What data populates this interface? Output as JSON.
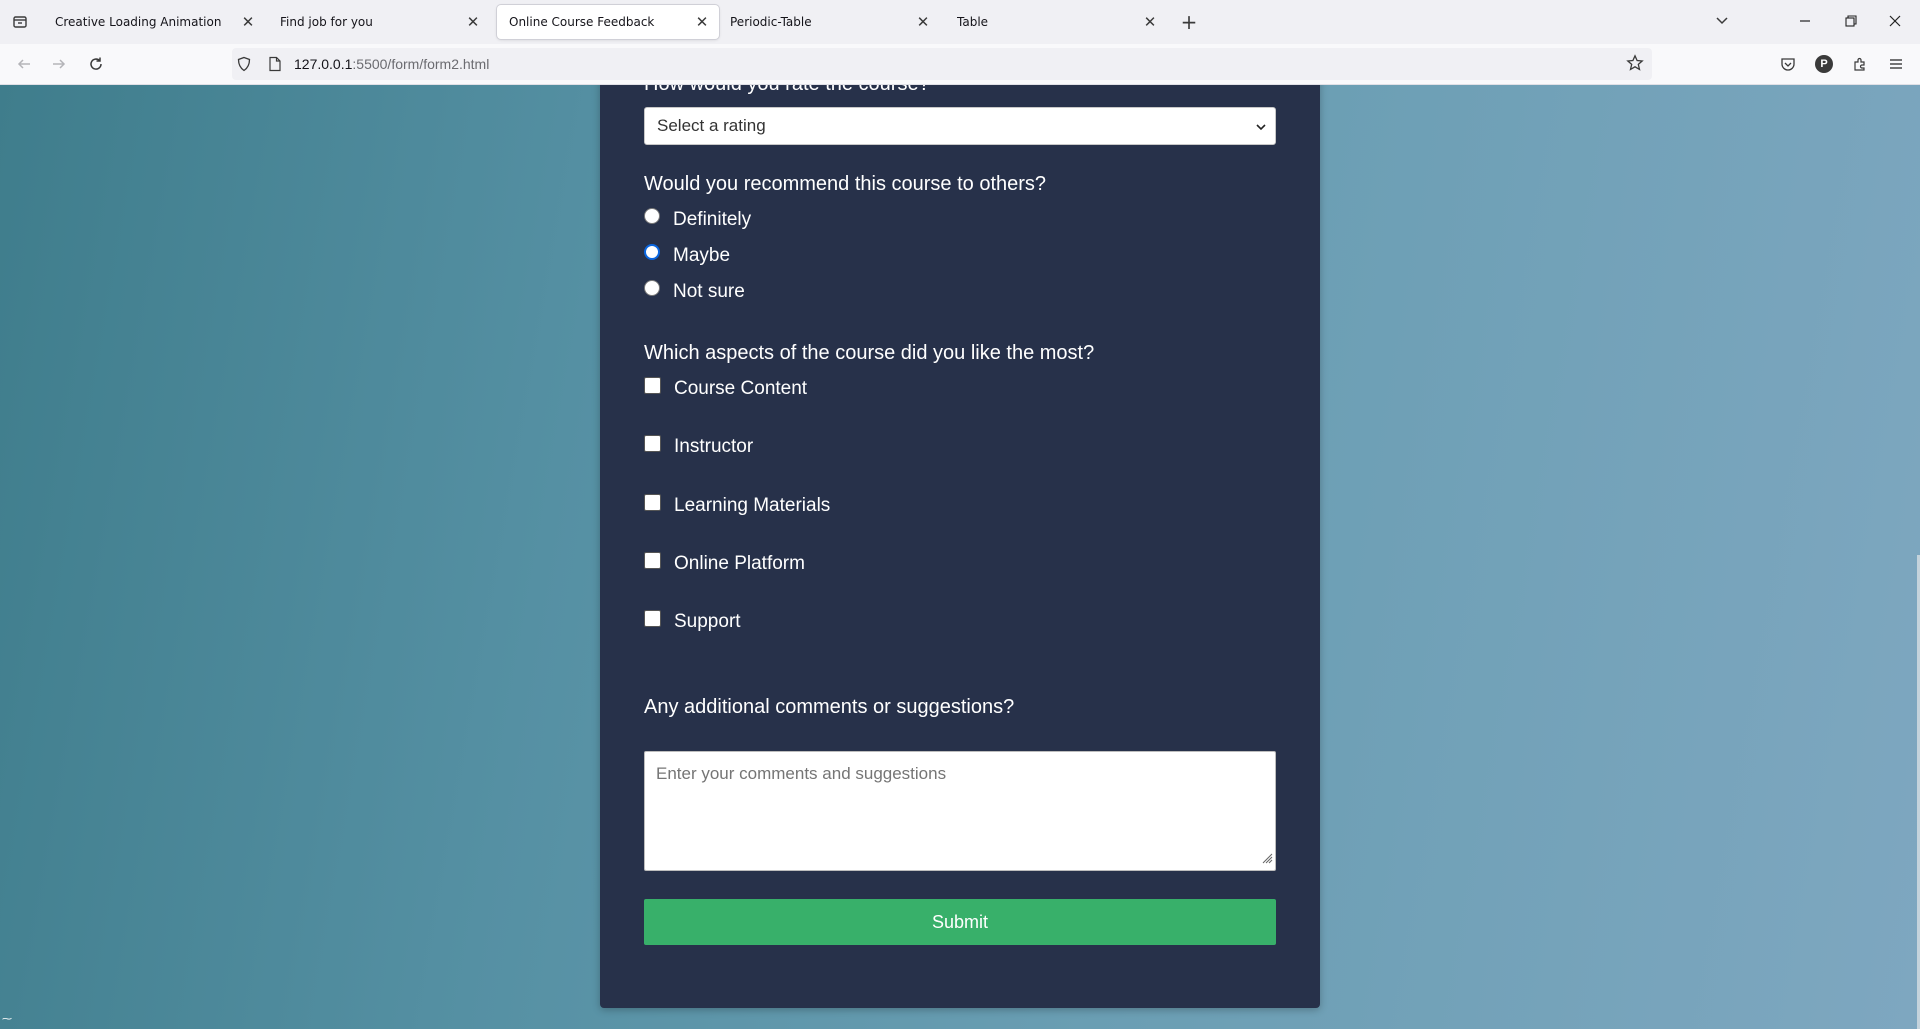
{
  "browser": {
    "tabs": [
      {
        "title": "Creative Loading Animation",
        "active": false
      },
      {
        "title": "Find job for you",
        "active": false
      },
      {
        "title": "Online Course Feedback",
        "active": true
      },
      {
        "title": "Periodic-Table",
        "active": false
      },
      {
        "title": "Table",
        "active": false
      }
    ],
    "url_host": "127.0.0.1",
    "url_rest": ":5500/form/form2.html",
    "profile_initial": "P"
  },
  "form": {
    "rating_question": "How would you rate the course?",
    "rating_select_value": "Select a rating",
    "recommend_question": "Would you recommend this course to others?",
    "recommend_options": [
      {
        "label": "Definitely",
        "checked": false
      },
      {
        "label": "Maybe",
        "checked": true
      },
      {
        "label": "Not sure",
        "checked": false
      }
    ],
    "aspects_question": "Which aspects of the course did you like the most?",
    "aspects_options": [
      {
        "label": "Course Content",
        "checked": false
      },
      {
        "label": "Instructor",
        "checked": false
      },
      {
        "label": "Learning Materials",
        "checked": false
      },
      {
        "label": "Online Platform",
        "checked": false
      },
      {
        "label": "Support",
        "checked": false
      }
    ],
    "comments_question": "Any additional comments or suggestions?",
    "comments_placeholder": "Enter your comments and suggestions",
    "submit_label": "Submit"
  },
  "colors": {
    "card": "#27314a",
    "submit": "#38b06a",
    "radio_checked": "#0a66e0"
  }
}
